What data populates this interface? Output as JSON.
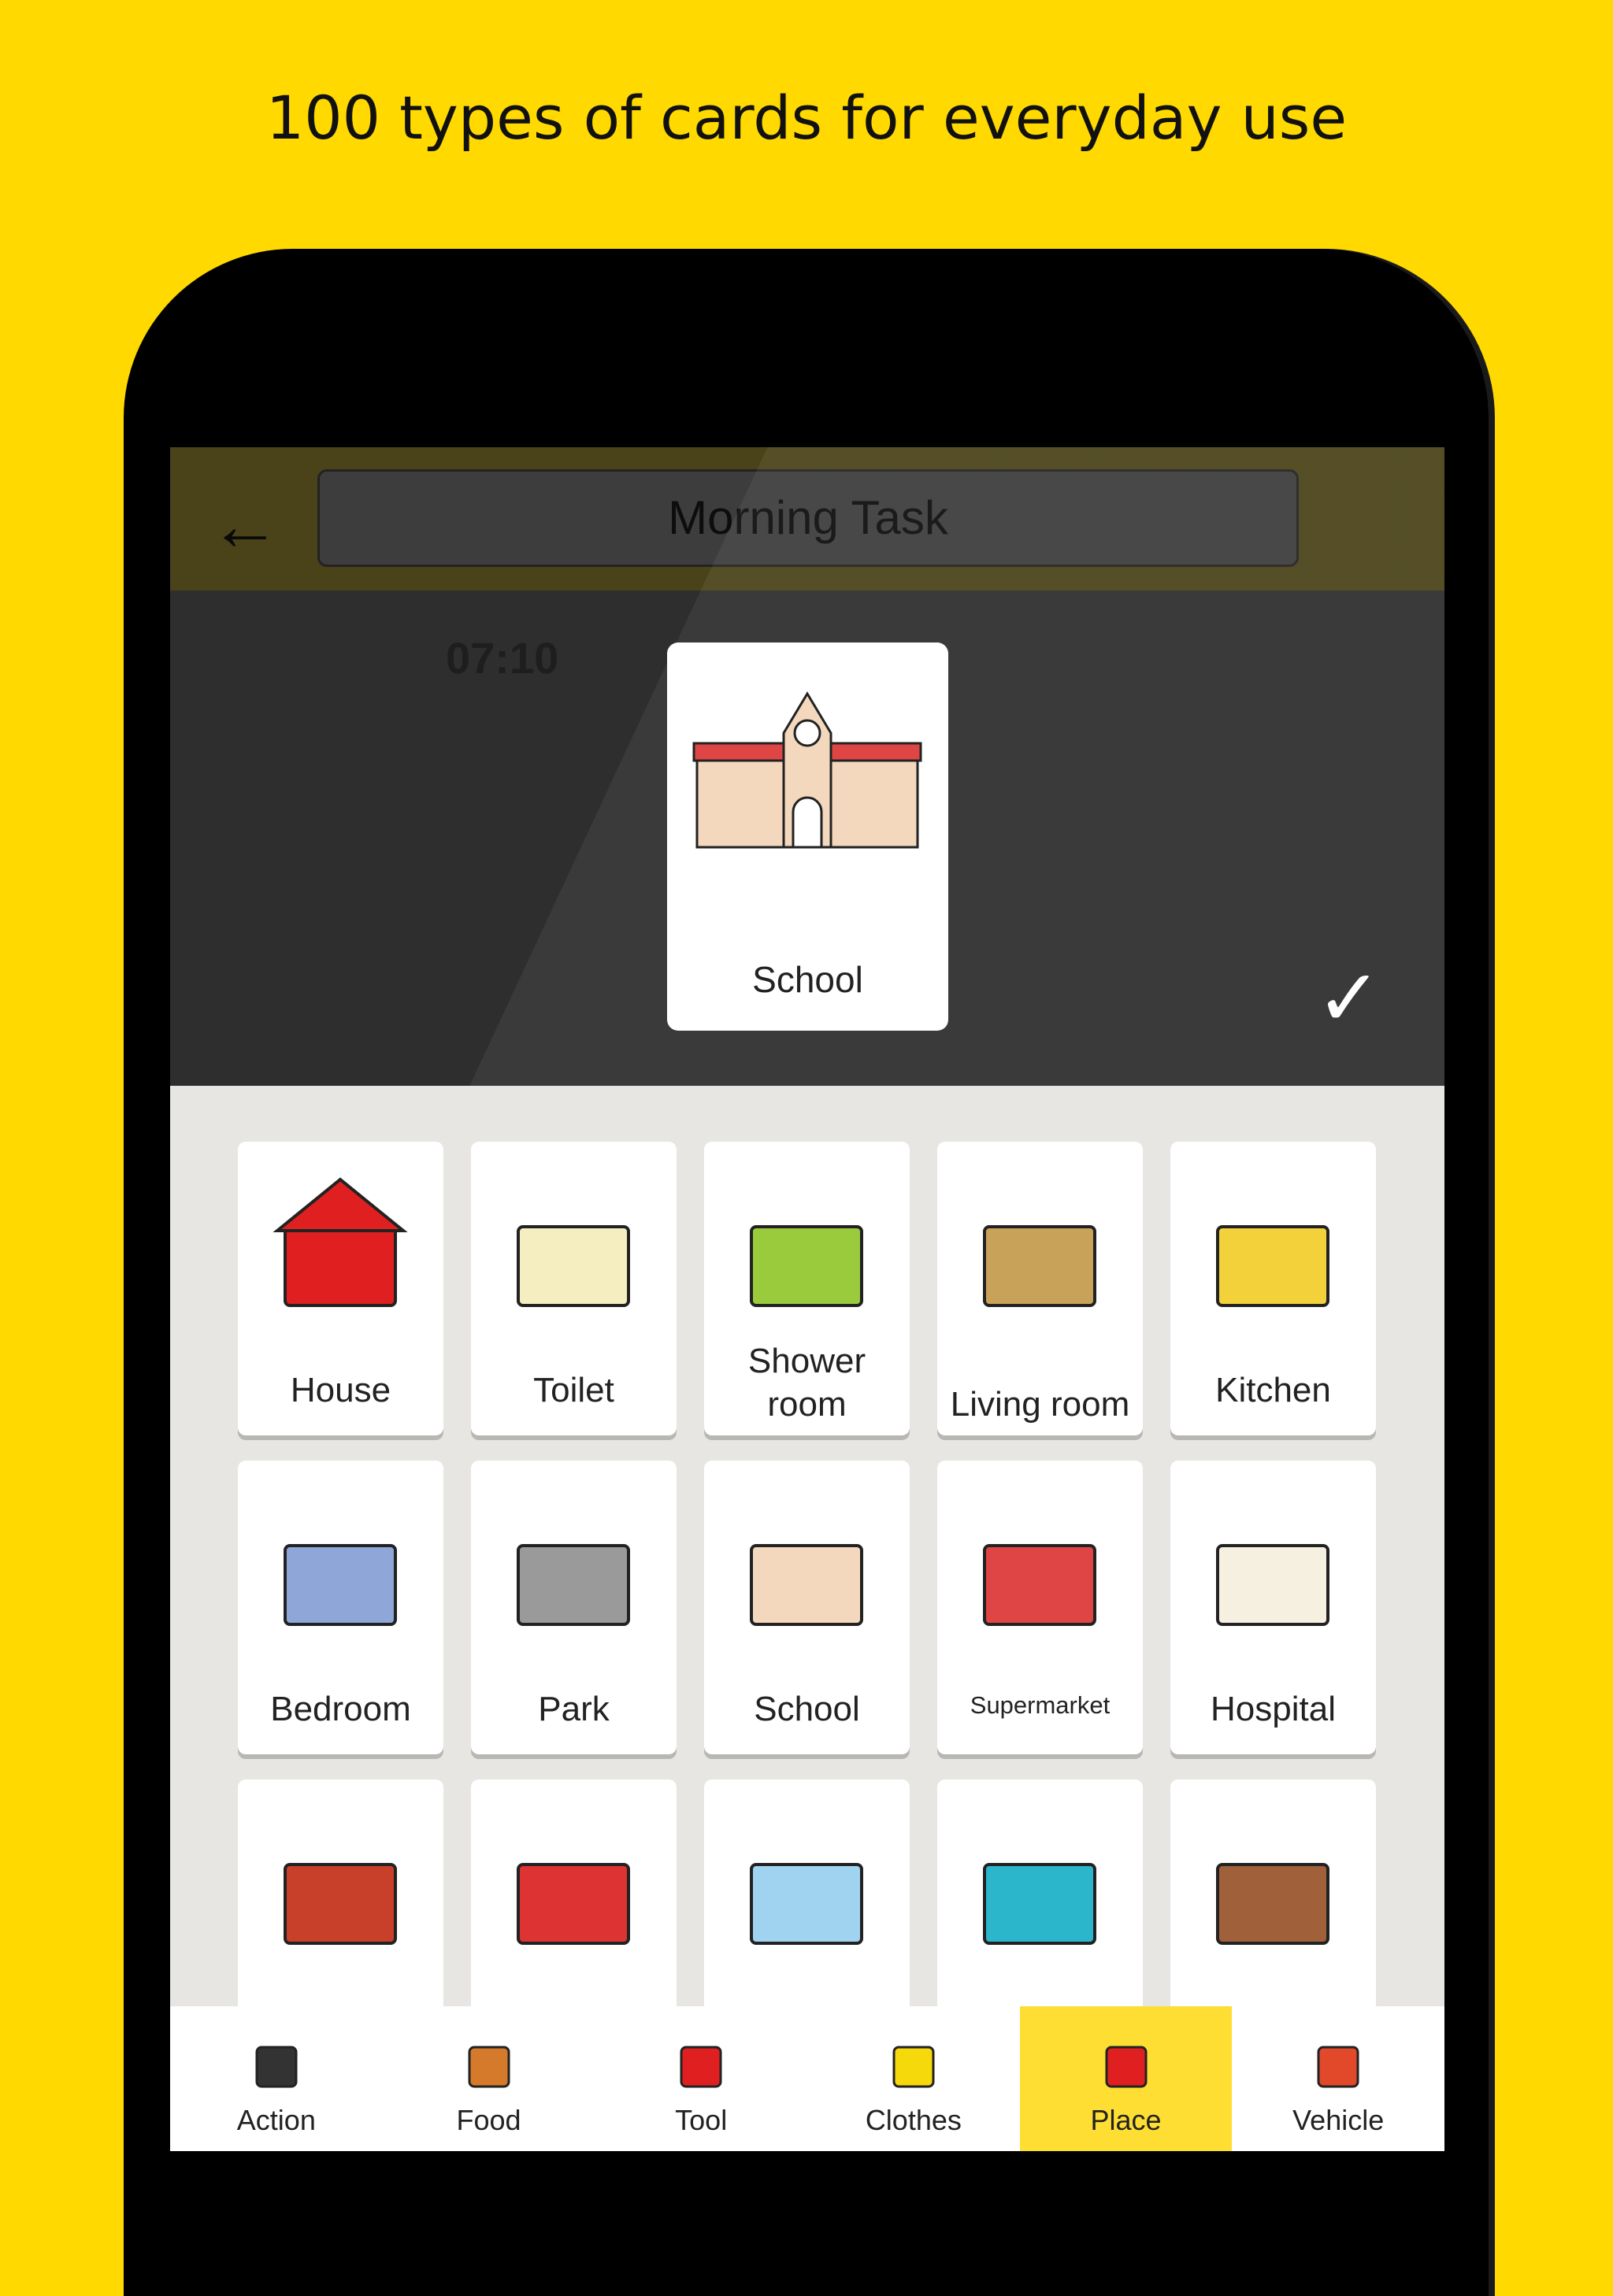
{
  "headline": "100 types of cards for everyday use",
  "header": {
    "back_icon": "arrow-left-icon",
    "title": "Morning Task"
  },
  "background": {
    "time": "07:10"
  },
  "popup": {
    "label": "School",
    "icon": "school-icon"
  },
  "confirm_icon": "checkmark-icon",
  "cards": [
    {
      "label": "House",
      "icon": "house-icon"
    },
    {
      "label": "Toilet",
      "icon": "toilet-icon"
    },
    {
      "label": "Shower room",
      "icon": "bathtub-icon"
    },
    {
      "label": "Living room",
      "icon": "sofa-icon"
    },
    {
      "label": "Kitchen",
      "icon": "kitchen-icon"
    },
    {
      "label": "Bedroom",
      "icon": "bed-icon"
    },
    {
      "label": "Park",
      "icon": "swing-icon"
    },
    {
      "label": "School",
      "icon": "school-icon"
    },
    {
      "label": "Supermarket",
      "icon": "store-icon"
    },
    {
      "label": "Hospital",
      "icon": "hospital-icon"
    },
    {
      "label": "",
      "icon": "station-icon"
    },
    {
      "label": "",
      "icon": "bus-stop-icon"
    },
    {
      "label": "",
      "icon": "zoo-icon"
    },
    {
      "label": "",
      "icon": "aquarium-icon"
    },
    {
      "label": "",
      "icon": "classroom-icon"
    }
  ],
  "tabs": [
    {
      "label": "Action",
      "icon": "person-drinking-icon"
    },
    {
      "label": "Food",
      "icon": "bread-icon"
    },
    {
      "label": "Tool",
      "icon": "toolbox-icon"
    },
    {
      "label": "Clothes",
      "icon": "shirt-icon"
    },
    {
      "label": "Place",
      "icon": "house-icon",
      "active": true
    },
    {
      "label": "Vehicle",
      "icon": "car-icon"
    }
  ],
  "colors": {
    "background": "#ffd900",
    "active_tab": "#ffde33",
    "panel": "#e8e6e2"
  }
}
